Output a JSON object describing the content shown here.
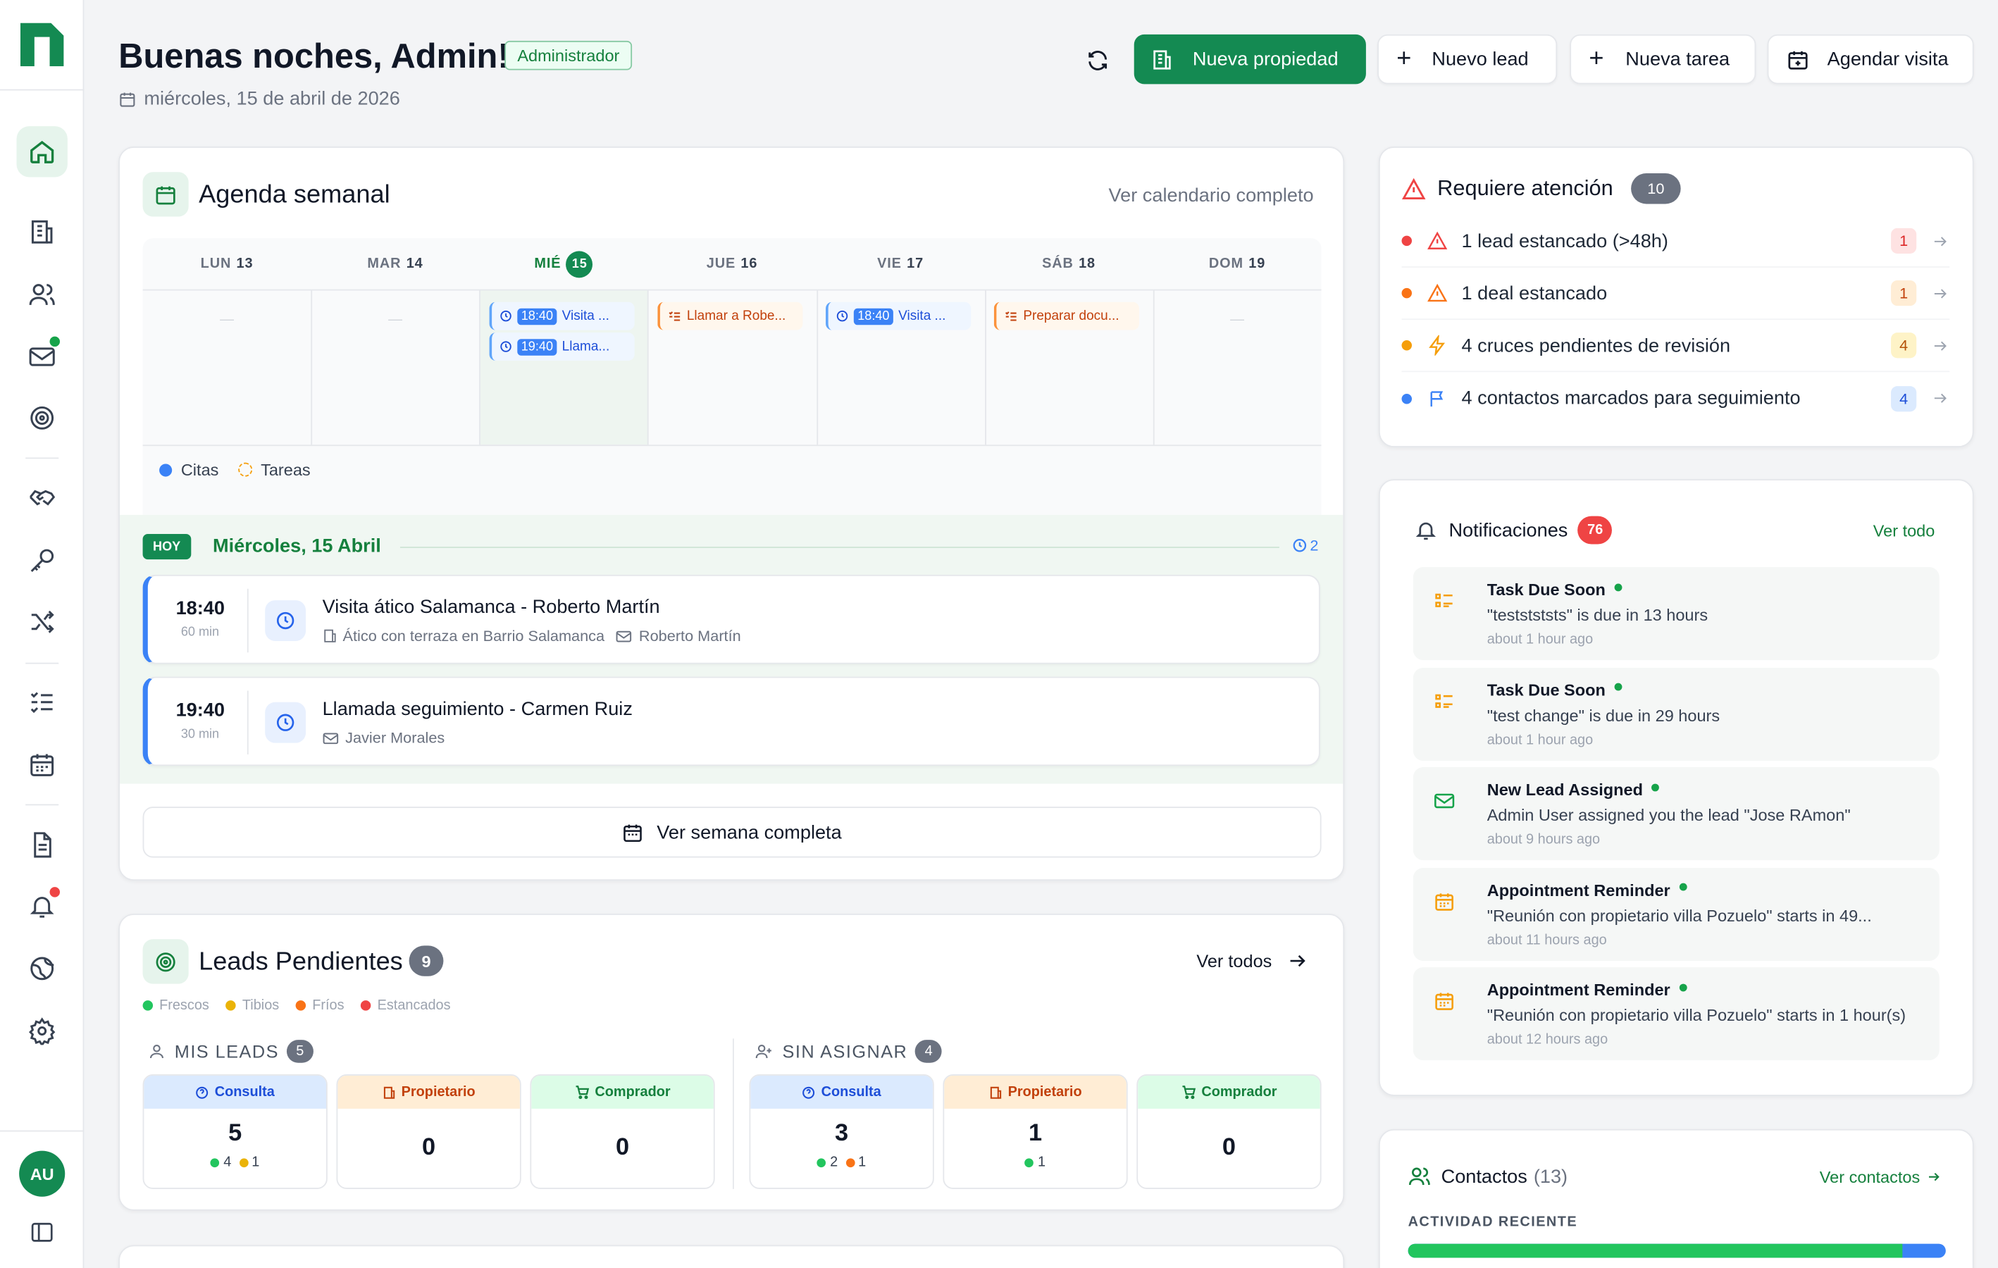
{
  "colors": {
    "brand": "#148a52",
    "accent_blue": "#3b82f6",
    "danger": "#ef4444",
    "warning": "#f59e0b",
    "orange": "#f97316"
  },
  "sidebar": {
    "logo": "n",
    "items": [
      {
        "icon": "home-icon",
        "active": true
      },
      {
        "icon": "building-icon"
      },
      {
        "icon": "users-icon"
      },
      {
        "icon": "mail-icon",
        "dot": "#16a34a"
      },
      {
        "icon": "target-icon"
      },
      {
        "icon": "handshake-icon"
      },
      {
        "icon": "key-icon"
      },
      {
        "icon": "shuffle-icon"
      },
      {
        "icon": "tasks-icon"
      },
      {
        "icon": "calendar-icon"
      },
      {
        "icon": "document-icon"
      },
      {
        "icon": "bell-icon",
        "dot": "#ef4444"
      },
      {
        "icon": "globe-icon"
      },
      {
        "icon": "settings-icon"
      }
    ],
    "avatar": "AU",
    "collapse_icon": "sidebar-toggle-icon"
  },
  "header": {
    "greeting": "Buenas noches, Admin!",
    "role_badge": "Administrador",
    "date": "miércoles, 15 de abril de 2026",
    "actions": {
      "new_property": "Nueva propiedad",
      "new_lead": "Nuevo lead",
      "new_task": "Nueva tarea",
      "schedule_visit": "Agendar visita"
    }
  },
  "agenda": {
    "title": "Agenda semanal",
    "link": "Ver calendario completo",
    "days": [
      {
        "label": "LUN",
        "num": "13"
      },
      {
        "label": "MAR",
        "num": "14"
      },
      {
        "label": "MIÉ",
        "num": "15",
        "today": true
      },
      {
        "label": "JUE",
        "num": "16"
      },
      {
        "label": "VIE",
        "num": "17"
      },
      {
        "label": "SÁB",
        "num": "18"
      },
      {
        "label": "DOM",
        "num": "19"
      }
    ],
    "empty_marker": "—",
    "events": {
      "wed_1_time": "18:40",
      "wed_1_text": "Visita ...",
      "wed_2_time": "19:40",
      "wed_2_text": "Llama...",
      "thu_1_text": "Llamar a Robe...",
      "fri_1_time": "18:40",
      "fri_1_text": "Visita ...",
      "sat_1_text": "Preparar docu..."
    },
    "legend": {
      "appointments": "Citas",
      "tasks": "Tareas"
    },
    "today": {
      "badge": "HOY",
      "label": "Miércoles, 15 Abril",
      "count": "2",
      "items": [
        {
          "time": "18:40",
          "duration": "60 min",
          "title": "Visita ático Salamanca - Roberto Martín",
          "property": "Ático con terraza en Barrio Salamanca",
          "contact": "Roberto Martín"
        },
        {
          "time": "19:40",
          "duration": "30 min",
          "title": "Llamada seguimiento - Carmen Ruiz",
          "contact": "Javier Morales"
        }
      ]
    },
    "week_button": "Ver semana completa"
  },
  "leads": {
    "title": "Leads Pendientes",
    "count": "9",
    "link": "Ver todos",
    "legend": [
      "Frescos",
      "Tibios",
      "Fríos",
      "Estancados"
    ],
    "mine": {
      "label": "MIS LEADS",
      "count": "5",
      "boxes": [
        {
          "label": "Consulta",
          "value": "5",
          "g": "4",
          "y": "1"
        },
        {
          "label": "Propietario",
          "value": "0"
        },
        {
          "label": "Comprador",
          "value": "0"
        }
      ]
    },
    "unassigned": {
      "label": "SIN ASIGNAR",
      "count": "4",
      "boxes": [
        {
          "label": "Consulta",
          "value": "3",
          "g": "2",
          "o": "1"
        },
        {
          "label": "Propietario",
          "value": "1",
          "g": "1"
        },
        {
          "label": "Comprador",
          "value": "0"
        }
      ]
    }
  },
  "attention": {
    "title": "Requiere atención",
    "count": "10",
    "items": [
      {
        "text": "1 lead estancado (>48h)",
        "count": "1",
        "color": "#ef4444"
      },
      {
        "text": "1 deal estancado",
        "count": "1",
        "color": "#f97316"
      },
      {
        "text": "4 cruces pendientes de revisión",
        "count": "4",
        "color": "#f59e0b"
      },
      {
        "text": "4 contactos marcados para seguimiento",
        "count": "4",
        "color": "#3b82f6"
      }
    ]
  },
  "notifications": {
    "title": "Notificaciones",
    "count": "76",
    "link": "Ver todo",
    "items": [
      {
        "title": "Task Due Soon",
        "desc": "\"teststststs\" is due in 13 hours",
        "ago": "about 1 hour ago",
        "icon": "task-icon"
      },
      {
        "title": "Task Due Soon",
        "desc": "\"test change\" is due in 29 hours",
        "ago": "about 1 hour ago",
        "icon": "task-icon"
      },
      {
        "title": "New Lead Assigned",
        "desc": "Admin User assigned you the lead \"Jose RAmon\"",
        "ago": "about 9 hours ago",
        "icon": "mail-icon"
      },
      {
        "title": "Appointment Reminder",
        "desc": "\"Reunión con propietario villa Pozuelo\" starts in 49...",
        "ago": "about 11 hours ago",
        "icon": "calendar-icon"
      },
      {
        "title": "Appointment Reminder",
        "desc": "\"Reunión con propietario villa Pozuelo\" starts in 1 hour(s)",
        "ago": "about 12 hours ago",
        "icon": "calendar-icon"
      }
    ]
  },
  "contacts": {
    "title": "Contactos",
    "count": "(13)",
    "link": "Ver contactos",
    "section": "ACTIVIDAD RECIENTE",
    "activity_fraction": 0.92
  }
}
